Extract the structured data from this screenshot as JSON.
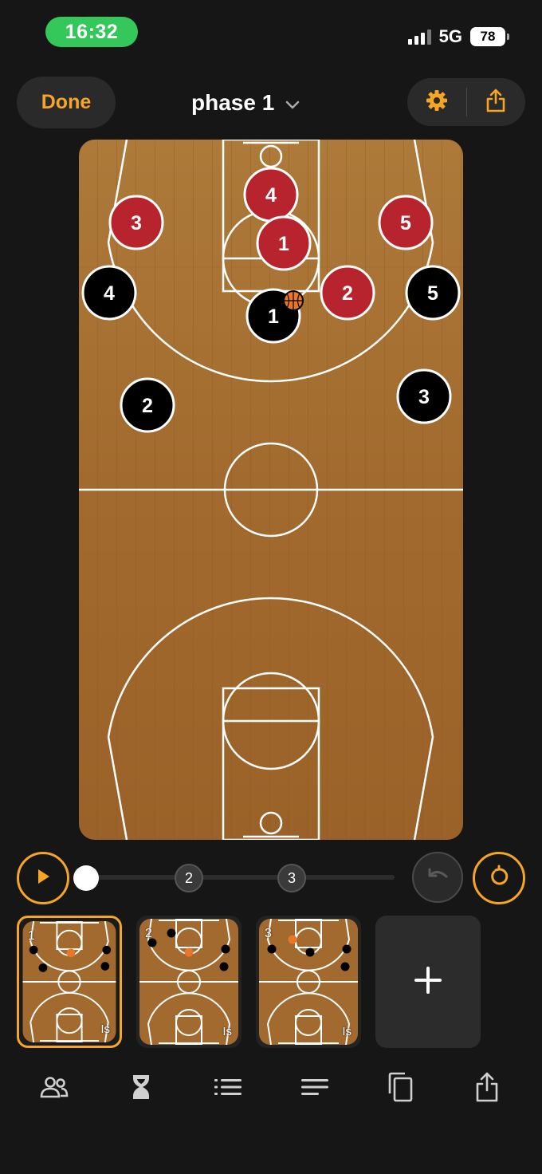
{
  "status": {
    "time": "16:32",
    "network": "5G",
    "battery": "78"
  },
  "header": {
    "done_label": "Done",
    "phase_title": "phase 1"
  },
  "colors": {
    "accent": "#f5a623",
    "offense": "#000000",
    "defense": "#b8242e",
    "court": "#a8692c",
    "ball": "#e8772a"
  },
  "players": {
    "defense": [
      "4",
      "3",
      "1",
      "5",
      "2"
    ],
    "offense": [
      "4",
      "1",
      "5",
      "2",
      "3"
    ]
  },
  "timeline": {
    "steps": [
      "2",
      "3"
    ],
    "current_step": 1
  },
  "phases": [
    {
      "number": "1",
      "tag": "Is",
      "selected": true
    },
    {
      "number": "2",
      "tag": "Is",
      "selected": false
    },
    {
      "number": "3",
      "tag": "Is",
      "selected": false
    }
  ],
  "add_phase_label": "+",
  "toolbar": [
    "players-icon",
    "hourglass-icon",
    "list-icon",
    "notes-icon",
    "duplicate-icon",
    "share-icon"
  ]
}
